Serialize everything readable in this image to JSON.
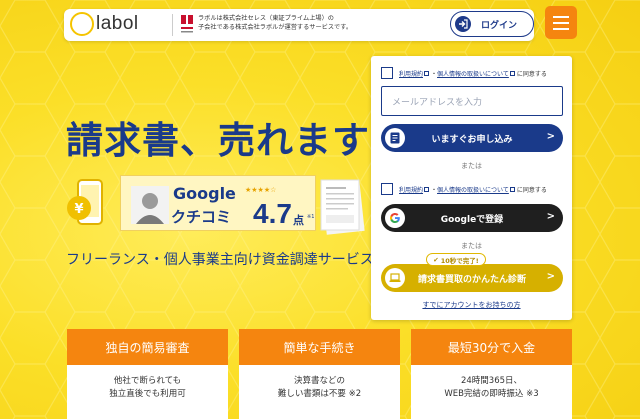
{
  "header": {
    "logo_text": "labol",
    "notice_line1": "ラボルは株式会社セレス（東証プライム上場）の",
    "notice_line2": "子会社である株式会社ラボルが運営するサービスです。",
    "login_label": "ログイン"
  },
  "hero": {
    "headline": "請求書、売れます",
    "rating_brand": "Google",
    "rating_source": "クチコミ",
    "rating_stars": "★★★★☆",
    "rating_score": "4.7",
    "rating_unit": "点",
    "rating_note": "※1",
    "subtitle": "フリーランス・個人事業主向け資金調達サービス"
  },
  "form": {
    "terms_link": "利用規約",
    "mid": "・",
    "privacy_link": "個人情報の取扱いについて",
    "agree_suffix": "に同意する",
    "email_placeholder": "メールアドレスを入力",
    "apply_label": "いますぐお申し込み",
    "or1": "または",
    "google_label": "Googleで登録",
    "or2": "または",
    "quick_badge": "10秒で完了!",
    "diagnose_label": "請求書買取のかんたん診断",
    "account_link": "すでにアカウントをお持ちの方"
  },
  "features": [
    {
      "title": "独自の簡易審査",
      "line1": "他社で断られても",
      "line2": "独立直後でも利用可"
    },
    {
      "title": "簡単な手続き",
      "line1": "決算書などの",
      "line2": "難しい書類は不要 ※2"
    },
    {
      "title": "最短30分で入金",
      "line1": "24時間365日、",
      "line2": "WEB完結の即時振込 ※3"
    }
  ],
  "colors": {
    "primary": "#1a3a8a",
    "accent": "#f5850f",
    "background": "#fbdf28",
    "gold": "#d6b000"
  }
}
